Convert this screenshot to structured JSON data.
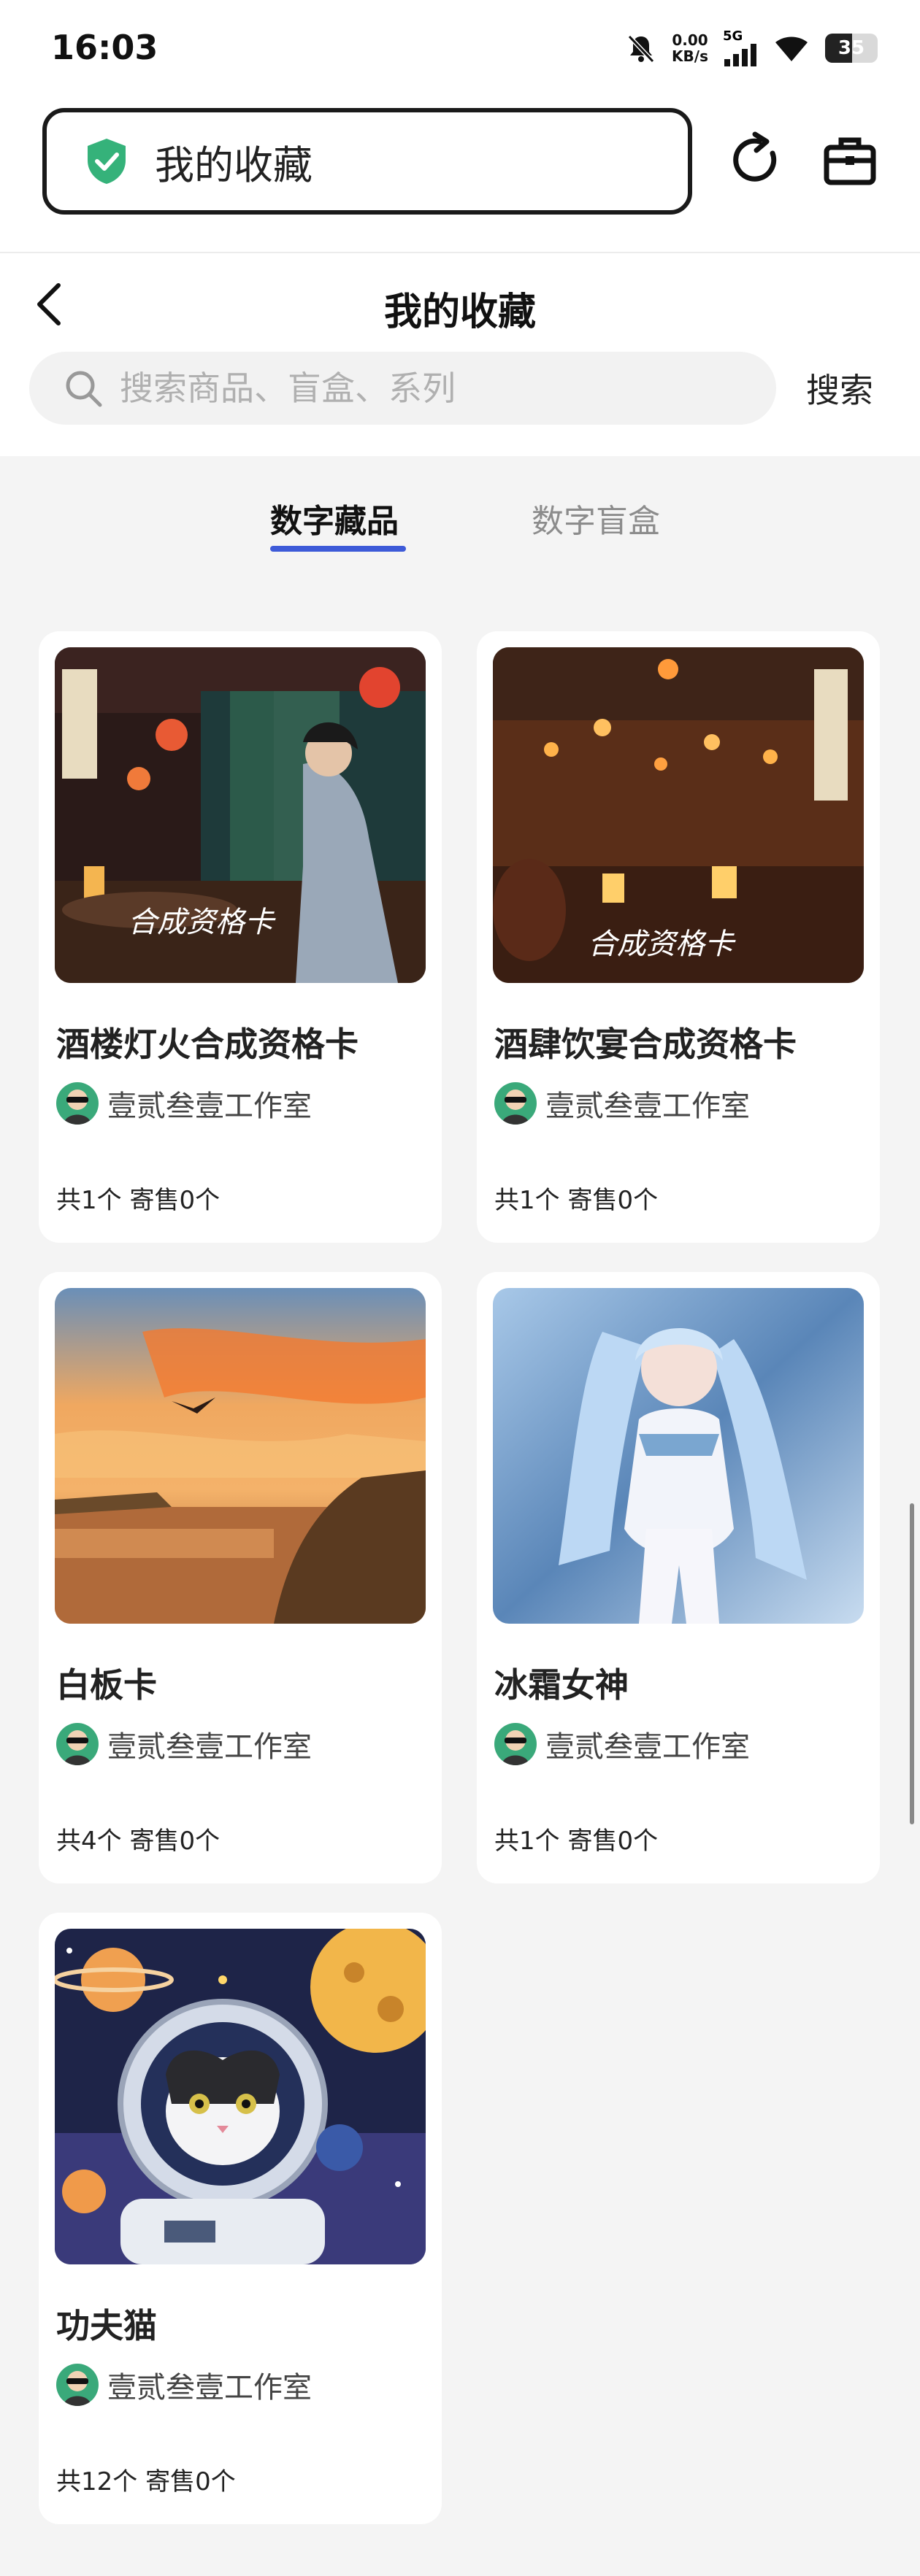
{
  "status_bar": {
    "time": "16:03",
    "net_speed_value": "0.00",
    "net_speed_unit": "KB/s",
    "network": "5G",
    "battery": "35"
  },
  "browser": {
    "address_text": "我的收藏"
  },
  "header": {
    "title": "我的收藏"
  },
  "search": {
    "placeholder": "搜索商品、盲盒、系列",
    "button": "搜索"
  },
  "tabs": [
    {
      "label": "数字藏品",
      "active": true
    },
    {
      "label": "数字盲盒",
      "active": false
    }
  ],
  "cards": [
    {
      "title": "酒楼灯火合成资格卡",
      "creator": "壹贰叁壹工作室",
      "count": "共1个 寄售0个",
      "image": "tavern-lantern-scene",
      "watermark": "合成资格卡"
    },
    {
      "title": "酒肆饮宴合成资格卡",
      "creator": "壹贰叁壹工作室",
      "count": "共1个 寄售0个",
      "image": "tavern-feast-scene",
      "watermark": "合成资格卡"
    },
    {
      "title": "白板卡",
      "creator": "壹贰叁壹工作室",
      "count": "共4个 寄售0个",
      "image": "sunset-lake-scene"
    },
    {
      "title": "冰霜女神",
      "creator": "壹贰叁壹工作室",
      "count": "共1个 寄售0个",
      "image": "frost-goddess-art"
    },
    {
      "title": "功夫猫",
      "creator": "壹贰叁壹工作室",
      "count": "共12个 寄售0个",
      "image": "astronaut-cat-art"
    }
  ],
  "colors": {
    "accent": "#3d5ad8",
    "shield": "#35b27a",
    "background": "#f4f4f4"
  }
}
